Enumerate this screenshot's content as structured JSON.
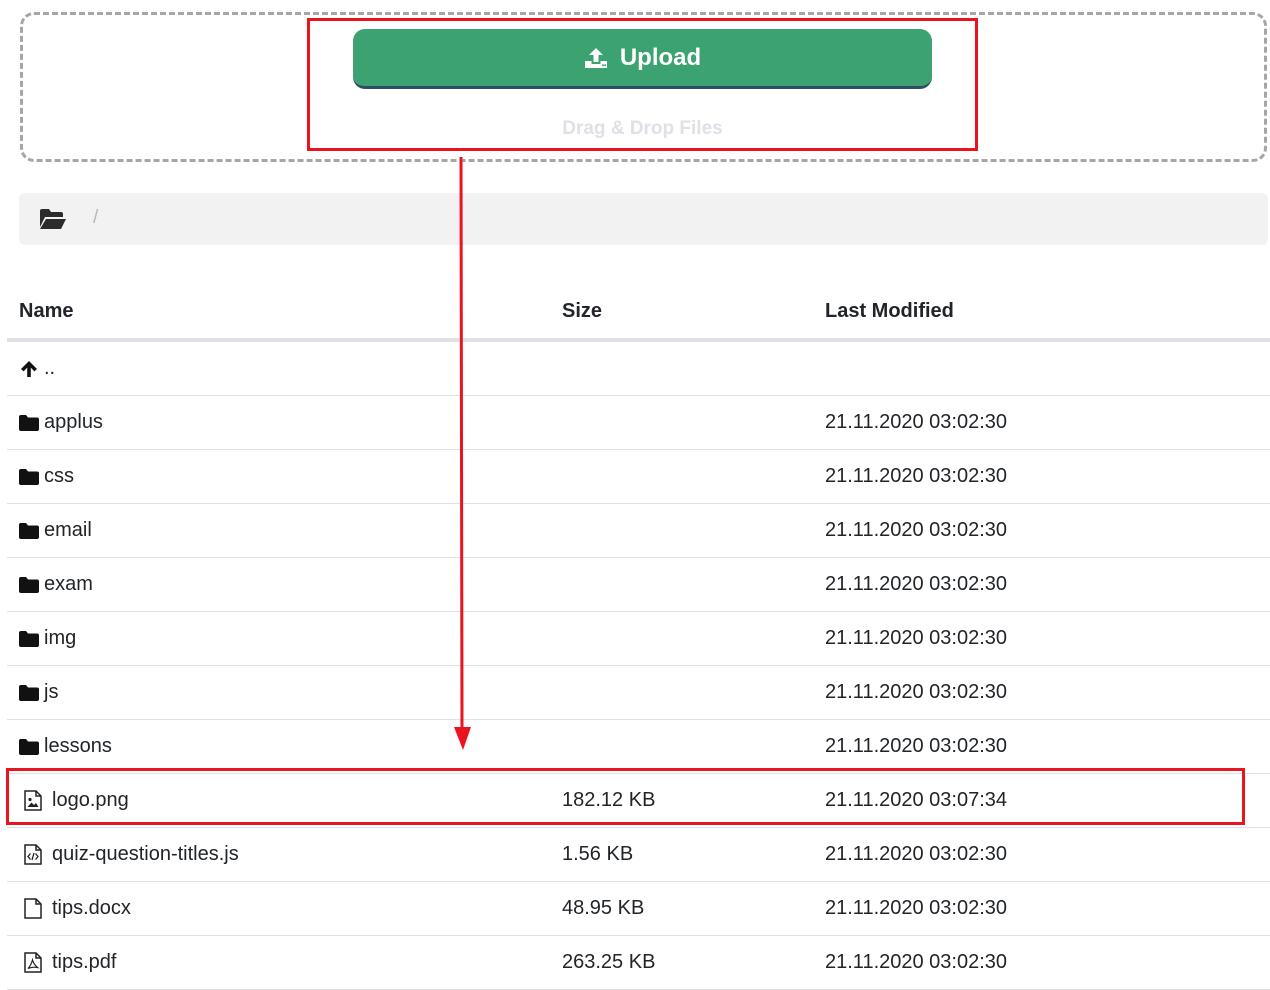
{
  "upload": {
    "button_label": "Upload",
    "drop_hint": "Drag & Drop Files"
  },
  "breadcrumb": {
    "separator": "/"
  },
  "table": {
    "headers": {
      "name": "Name",
      "size": "Size",
      "modified": "Last Modified"
    },
    "parent": {
      "label": ".."
    },
    "rows": [
      {
        "name": "applus",
        "icon": "folder-icon",
        "size": "",
        "modified": "21.11.2020 03:02:30"
      },
      {
        "name": "css",
        "icon": "folder-icon",
        "size": "",
        "modified": "21.11.2020 03:02:30"
      },
      {
        "name": "email",
        "icon": "folder-icon",
        "size": "",
        "modified": "21.11.2020 03:02:30"
      },
      {
        "name": "exam",
        "icon": "folder-icon",
        "size": "",
        "modified": "21.11.2020 03:02:30"
      },
      {
        "name": "img",
        "icon": "folder-icon",
        "size": "",
        "modified": "21.11.2020 03:02:30"
      },
      {
        "name": "js",
        "icon": "folder-icon",
        "size": "",
        "modified": "21.11.2020 03:02:30"
      },
      {
        "name": "lessons",
        "icon": "folder-icon",
        "size": "",
        "modified": "21.11.2020 03:02:30"
      },
      {
        "name": "logo.png",
        "icon": "image-file-icon",
        "size": "182.12 KB",
        "modified": "21.11.2020 03:07:34"
      },
      {
        "name": "quiz-question-titles.js",
        "icon": "code-file-icon",
        "size": "1.56 KB",
        "modified": "21.11.2020 03:02:30"
      },
      {
        "name": "tips.docx",
        "icon": "file-icon",
        "size": "48.95 KB",
        "modified": "21.11.2020 03:02:30"
      },
      {
        "name": "tips.pdf",
        "icon": "pdf-file-icon",
        "size": "263.25 KB",
        "modified": "21.11.2020 03:02:30"
      }
    ]
  },
  "colors": {
    "upload_button": "#3da271",
    "annotation": "#e8141e",
    "breadcrumb_bg": "#f2f2f2"
  }
}
